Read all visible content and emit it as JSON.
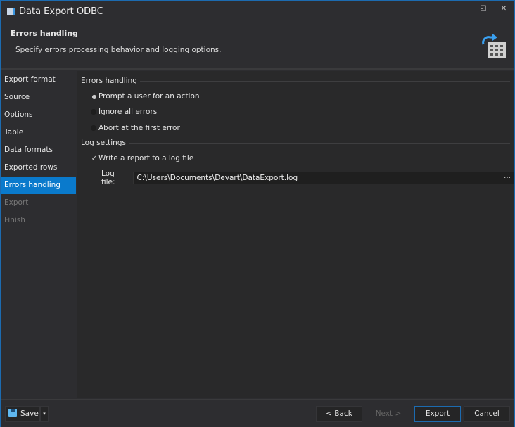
{
  "window": {
    "title": "Data Export ODBC",
    "minimize": "–",
    "maximize": "☐",
    "close": "✕"
  },
  "header": {
    "title": "Errors handling",
    "subtitle": "Specify errors processing behavior and logging options."
  },
  "sidebar": {
    "items": [
      {
        "label": "Export format",
        "state": "normal"
      },
      {
        "label": "Source",
        "state": "normal"
      },
      {
        "label": "Options",
        "state": "normal"
      },
      {
        "label": "Table",
        "state": "normal"
      },
      {
        "label": "Data formats",
        "state": "normal"
      },
      {
        "label": "Exported rows",
        "state": "normal"
      },
      {
        "label": "Errors handling",
        "state": "selected"
      },
      {
        "label": "Export",
        "state": "disabled"
      },
      {
        "label": "Finish",
        "state": "disabled"
      }
    ]
  },
  "errors": {
    "group": "Errors handling",
    "options": [
      {
        "label": "Prompt a user for an action",
        "checked": true
      },
      {
        "label": "Ignore all errors",
        "checked": false
      },
      {
        "label": "Abort at the first error",
        "checked": false
      }
    ]
  },
  "log": {
    "group": "Log settings",
    "write_label": "Write a report to a log file",
    "write_checked": true,
    "file_label": "Log file:",
    "file_value": "C:\\Users\\Documents\\Devart\\DataExport.log",
    "browse": "···"
  },
  "footer": {
    "save": "Save",
    "back": "< Back",
    "next": "Next >",
    "export": "Export",
    "cancel": "Cancel"
  },
  "colors": {
    "accent": "#0a7acc"
  }
}
